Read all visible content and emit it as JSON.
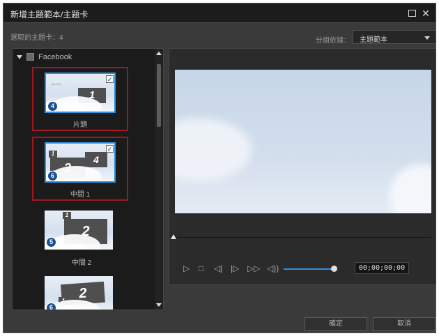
{
  "window": {
    "title": "新增主題範本/主題卡"
  },
  "header": {
    "selected_count_label": "選取的主題卡：4",
    "group_by_label": "分組依據：",
    "group_by_value": "主題範本"
  },
  "tree": {
    "group_label": "Facebook",
    "items": [
      {
        "label": "片頭",
        "badge": "4",
        "selected": true,
        "main_number": "1"
      },
      {
        "label": "中間 1",
        "badge": "6",
        "selected": true,
        "main_number": "3",
        "second_number": "4",
        "small_number": "1"
      },
      {
        "label": "中間 2",
        "badge": "5",
        "selected": false,
        "main_number": "2",
        "small_number": "1"
      },
      {
        "label": "",
        "badge": "6",
        "selected": false,
        "main_number": "2",
        "small_number": "1"
      }
    ]
  },
  "player": {
    "timecode": "00;00;00;00"
  },
  "footer": {
    "ok_label": "確定",
    "cancel_label": "取消"
  },
  "colors": {
    "selection_border": "#a3161b",
    "accent": "#2f8fe0"
  },
  "icons": [
    "maximize-icon",
    "close-icon",
    "chevron-down-icon",
    "play-icon",
    "stop-icon",
    "prev-frame-icon",
    "next-frame-icon",
    "fast-forward-icon",
    "volume-icon"
  ]
}
